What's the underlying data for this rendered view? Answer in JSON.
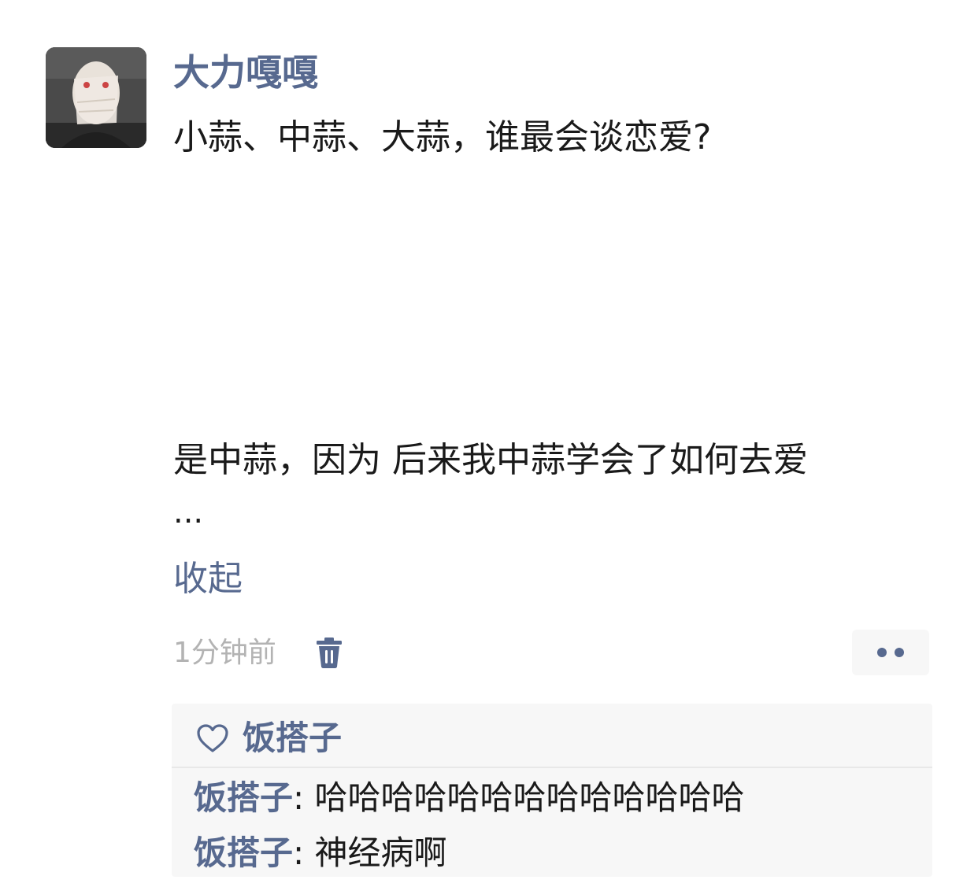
{
  "post": {
    "author": "大力嘎嘎",
    "title": "小蒜、中蒜、大蒜，谁最会谈恋爱?",
    "body": "是中蒜，因为 后来我中蒜学会了如何去爱",
    "ellipsis": "...",
    "collapse_label": "收起",
    "time": "1分钟前"
  },
  "likes": {
    "names": "饭搭子"
  },
  "comments": [
    {
      "name": "饭搭子",
      "separator": ":",
      "text": "哈哈哈哈哈哈哈哈哈哈哈哈哈"
    },
    {
      "name": "饭搭子",
      "separator": ":",
      "text": "神经病啊"
    }
  ],
  "icons": {
    "avatar": "masked-face-photo",
    "delete": "trash-icon",
    "more": "two-dots-icon",
    "like": "heart-outline-icon"
  },
  "colors": {
    "link": "#57698f",
    "text": "#1a1a1a",
    "muted": "#b3b3b3",
    "panel": "#f7f7f7"
  }
}
